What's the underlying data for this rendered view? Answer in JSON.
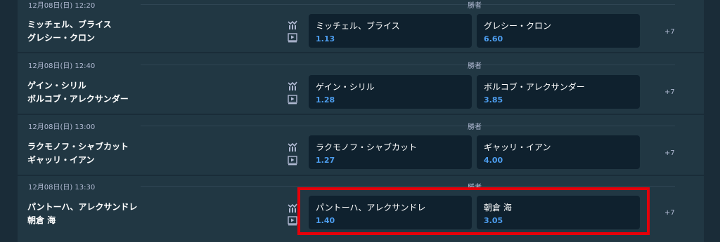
{
  "matches": [
    {
      "date": "12月08日(日) 12:20",
      "market": "勝者",
      "player1": "ミッチェル、ブライス",
      "player2": "グレシー・クロン",
      "odds": [
        {
          "name": "ミッチェル、ブライス",
          "value": "1.13"
        },
        {
          "name": "グレシー・クロン",
          "value": "6.60"
        }
      ],
      "more": "+7"
    },
    {
      "date": "12月08日(日) 12:40",
      "market": "勝者",
      "player1": "ゲイン・シリル",
      "player2": "ボルコブ・アレクサンダー",
      "odds": [
        {
          "name": "ゲイン・シリル",
          "value": "1.28"
        },
        {
          "name": "ボルコブ・アレクサンダー",
          "value": "3.85"
        }
      ],
      "more": "+7"
    },
    {
      "date": "12月08日(日) 13:00",
      "market": "勝者",
      "player1": "ラクモノフ・シャブカット",
      "player2": "ギャッリ・イアン",
      "odds": [
        {
          "name": "ラクモノフ・シャブカット",
          "value": "1.27"
        },
        {
          "name": "ギャッリ・イアン",
          "value": "4.00"
        }
      ],
      "more": "+7"
    },
    {
      "date": "12月08日(日) 13:30",
      "market": "勝者",
      "player1": "パントーハ、アレクサンドレ",
      "player2": "朝倉 海",
      "odds": [
        {
          "name": "パントーハ、アレクサンドレ",
          "value": "1.40"
        },
        {
          "name": "朝倉 海",
          "value": "3.05"
        }
      ],
      "more": "+7"
    }
  ],
  "colors": {
    "background": "#1a2c38",
    "panel": "#213743",
    "odd_button": "#0f212e",
    "odd_value": "#4d9ef0",
    "highlight": "#e5000a"
  },
  "icons": [
    "stats-icon",
    "play-icon"
  ]
}
